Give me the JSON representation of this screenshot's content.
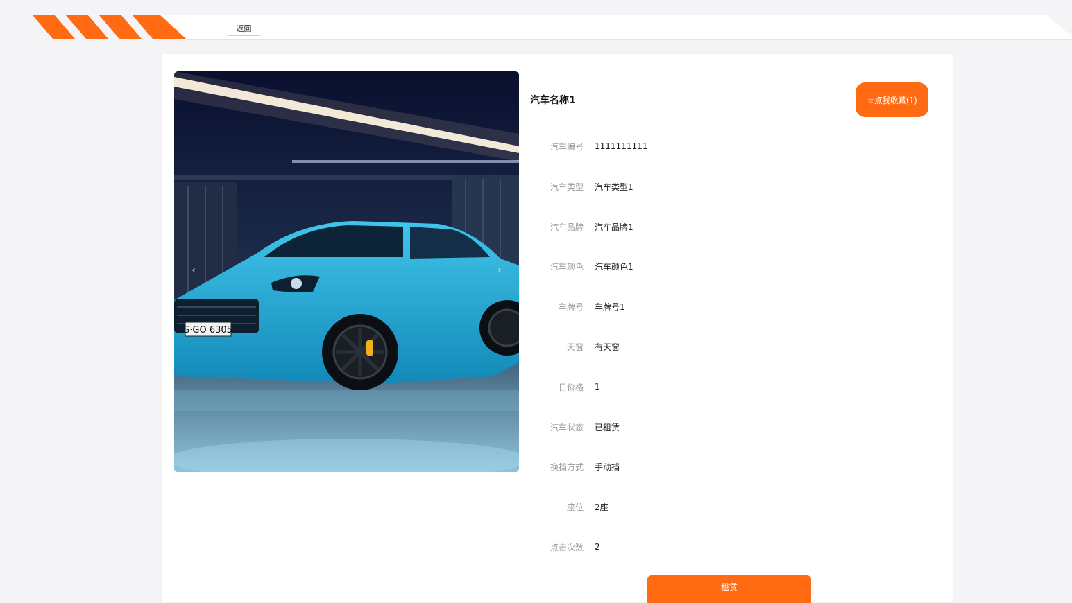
{
  "header": {
    "back_label": "返回",
    "accent_color": "#ff6a13"
  },
  "car": {
    "name": "汽车名称1",
    "favorite_label": "☆点我收藏(1)",
    "image_icon": "car-photo",
    "carousel_prev": "‹",
    "carousel_next": "›",
    "plate_text": "S·GO 6305"
  },
  "details": [
    {
      "label": "汽车编号",
      "value": "1111111111"
    },
    {
      "label": "汽车类型",
      "value": "汽车类型1"
    },
    {
      "label": "汽车品牌",
      "value": "汽车品牌1"
    },
    {
      "label": "汽车颜色",
      "value": "汽车颜色1"
    },
    {
      "label": "车牌号",
      "value": "车牌号1"
    },
    {
      "label": "天窗",
      "value": "有天窗"
    },
    {
      "label": "日价格",
      "value": "1"
    },
    {
      "label": "汽车状态",
      "value": "已租赁"
    },
    {
      "label": "换挡方式",
      "value": "手动挡"
    },
    {
      "label": "座位",
      "value": "2座"
    },
    {
      "label": "点击次数",
      "value": "2"
    }
  ],
  "actions": {
    "rent_label": "租赁"
  }
}
